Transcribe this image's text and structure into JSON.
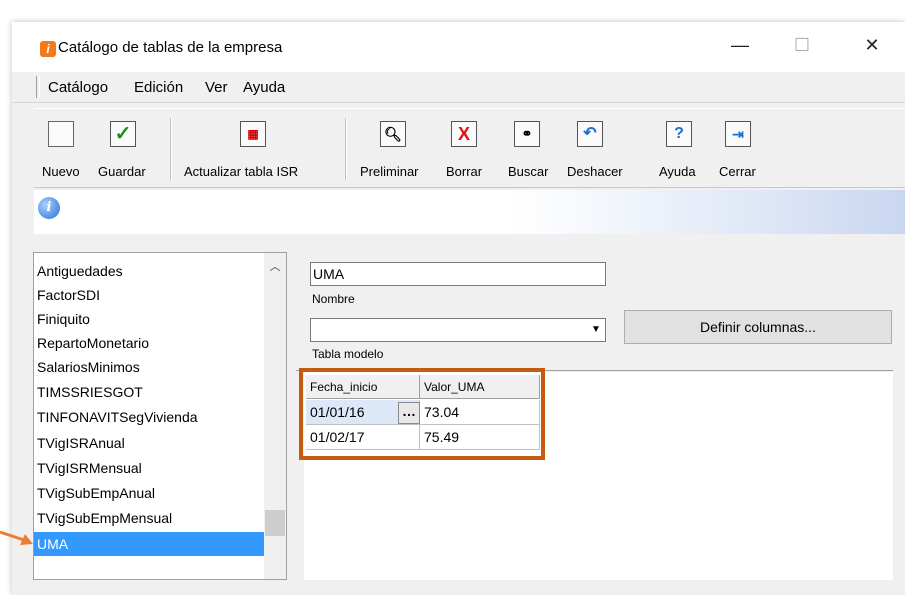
{
  "window": {
    "title": "Catálogo de tablas de la empresa",
    "controls": {
      "minimize": "—",
      "maximize": "☐",
      "close": "✕"
    }
  },
  "menu": {
    "items": [
      "Catálogo",
      "Edición",
      "Ver",
      "Ayuda"
    ]
  },
  "toolbar": {
    "buttons": [
      {
        "label": "Nuevo",
        "icon": "new-page-icon"
      },
      {
        "label": "Guardar",
        "icon": "checkmark-icon"
      },
      {
        "label": "Actualizar tabla ISR",
        "icon": "update-isr-icon"
      },
      {
        "label": "Preliminar",
        "icon": "print-preview-icon"
      },
      {
        "label": "Borrar",
        "icon": "delete-icon"
      },
      {
        "label": "Buscar",
        "icon": "binoculars-icon"
      },
      {
        "label": "Deshacer",
        "icon": "undo-icon"
      },
      {
        "label": "Ayuda",
        "icon": "help-icon"
      },
      {
        "label": "Cerrar",
        "icon": "exit-icon"
      }
    ]
  },
  "infobar": {
    "icon": "info-icon"
  },
  "tables_list": {
    "items": [
      "Antiguedades",
      "FactorSDI",
      "Finiquito",
      "RepartoMonetario",
      "SalariosMinimos",
      "TIMSSRIESGOT",
      "TINFONAVITSegVivienda",
      "TVigISRAnual",
      "TVigISRMensual",
      "TVigSubEmpAnual",
      "TVigSubEmpMensual",
      "UMA"
    ],
    "selected": "UMA"
  },
  "form": {
    "nombre_value": "UMA",
    "nombre_label": "Nombre",
    "tabla_modelo_value": "",
    "tabla_modelo_label": "Tabla modelo",
    "definir_columnas_label": "Definir columnas..."
  },
  "grid": {
    "columns": [
      "Fecha_inicio",
      "Valor_UMA"
    ],
    "rows": [
      [
        "01/01/16",
        "73.04"
      ],
      [
        "01/02/17",
        "75.49"
      ]
    ]
  },
  "colors": {
    "selection": "#3399ff",
    "highlight_box": "#c55a11",
    "arrow": "#ed7d31"
  }
}
